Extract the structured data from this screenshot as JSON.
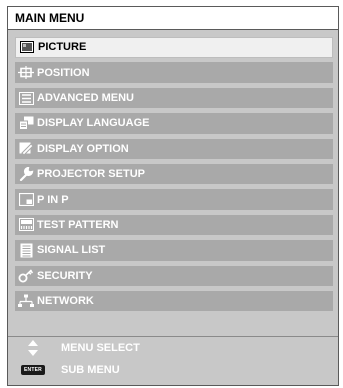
{
  "title": "MAIN MENU",
  "items": [
    {
      "label": "PICTURE",
      "icon": "picture-icon",
      "selected": true
    },
    {
      "label": "POSITION",
      "icon": "position-icon"
    },
    {
      "label": "ADVANCED MENU",
      "icon": "advanced-menu-icon"
    },
    {
      "label": "DISPLAY LANGUAGE",
      "icon": "display-language-icon"
    },
    {
      "label": "DISPLAY OPTION",
      "icon": "display-option-icon"
    },
    {
      "label": "PROJECTOR SETUP",
      "icon": "projector-setup-icon"
    },
    {
      "label": "P IN P",
      "icon": "p-in-p-icon"
    },
    {
      "label": "TEST PATTERN",
      "icon": "test-pattern-icon"
    },
    {
      "label": "SIGNAL LIST",
      "icon": "signal-list-icon"
    },
    {
      "label": "SECURITY",
      "icon": "security-key-icon"
    },
    {
      "label": "NETWORK",
      "icon": "network-icon"
    }
  ],
  "footer": {
    "menu_select": "MENU SELECT",
    "sub_menu": "SUB MENU",
    "enter_badge": "ENTER"
  },
  "colors": {
    "panel_bg": "#c8c8c8",
    "item_bg": "#a9a9a9",
    "selected_bg": "#f0f0f0",
    "text_light": "#ffffff",
    "text_dark": "#000000"
  }
}
